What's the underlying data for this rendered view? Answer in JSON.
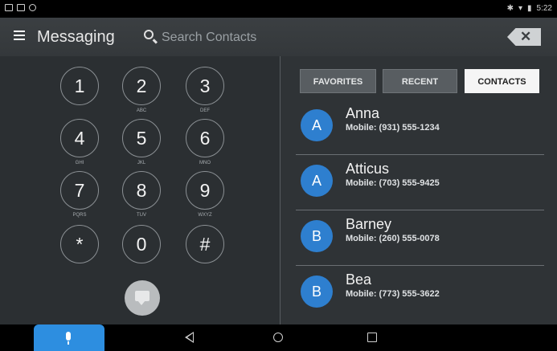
{
  "status_bar": {
    "time": "5:22"
  },
  "app_bar": {
    "title": "Messaging",
    "search_placeholder": "Search Contacts"
  },
  "dialpad": {
    "keys": [
      {
        "digit": "1",
        "letters": ""
      },
      {
        "digit": "2",
        "letters": "ABC"
      },
      {
        "digit": "3",
        "letters": "DEF"
      },
      {
        "digit": "4",
        "letters": "GHI"
      },
      {
        "digit": "5",
        "letters": "JKL"
      },
      {
        "digit": "6",
        "letters": "MNO"
      },
      {
        "digit": "7",
        "letters": "PQRS"
      },
      {
        "digit": "8",
        "letters": "TUV"
      },
      {
        "digit": "9",
        "letters": "WXYZ"
      },
      {
        "digit": "*",
        "letters": ""
      },
      {
        "digit": "0",
        "letters": ""
      },
      {
        "digit": "#",
        "letters": ""
      }
    ]
  },
  "tabs": [
    {
      "label": "FAVORITES",
      "active": false
    },
    {
      "label": "RECENT",
      "active": false
    },
    {
      "label": "CONTACTS",
      "active": true
    }
  ],
  "contacts": [
    {
      "initial": "A",
      "name": "Anna",
      "phone": "Mobile: (931) 555-1234"
    },
    {
      "initial": "A",
      "name": "Atticus",
      "phone": "Mobile: (703) 555-9425"
    },
    {
      "initial": "B",
      "name": "Barney",
      "phone": "Mobile: (260) 555-0078"
    },
    {
      "initial": "B",
      "name": "Bea",
      "phone": "Mobile: (773) 555-3622"
    }
  ],
  "colors": {
    "accent": "#2d8ee0",
    "avatar": "#2e7fcf"
  }
}
